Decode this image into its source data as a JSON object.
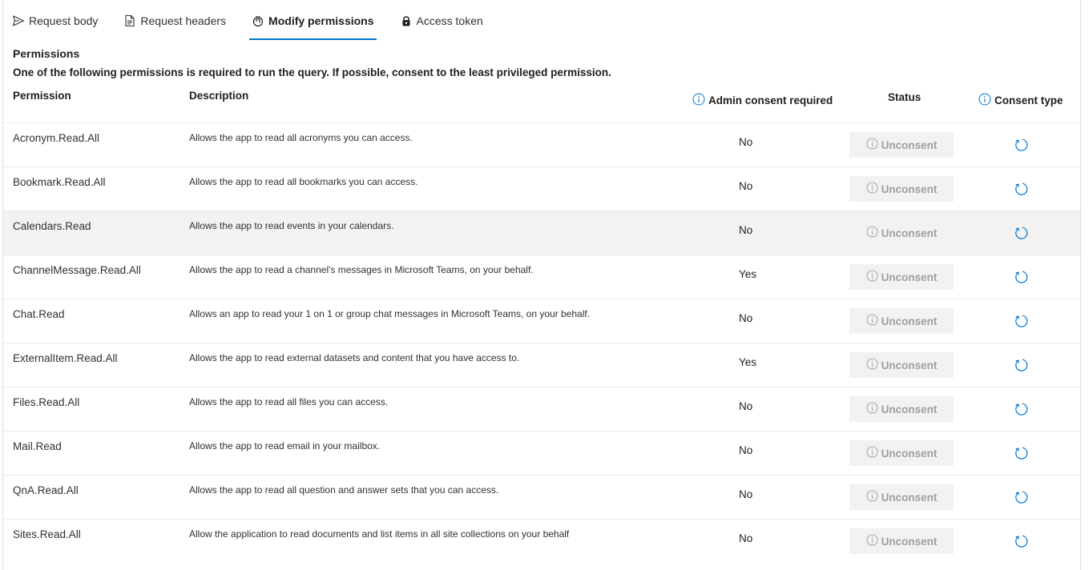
{
  "tabs": [
    {
      "label": "Request body",
      "icon": "send-icon",
      "active": false
    },
    {
      "label": "Request headers",
      "icon": "document-header-icon",
      "active": false
    },
    {
      "label": "Modify permissions",
      "icon": "shield-hand-icon",
      "active": true
    },
    {
      "label": "Access token",
      "icon": "lock-icon",
      "active": false
    }
  ],
  "section": {
    "title": "Permissions",
    "description": "One of the following permissions is required to run the query. If possible, consent to the least privileged permission."
  },
  "columns": {
    "permission": "Permission",
    "description": "Description",
    "admin_consent": "Admin consent required",
    "status": "Status",
    "consent_type": "Consent type"
  },
  "status_button_label": "Unconsent",
  "rows": [
    {
      "permission": "Acronym.Read.All",
      "description": "Allows the app to read all acronyms you can access.",
      "admin": "No"
    },
    {
      "permission": "Bookmark.Read.All",
      "description": "Allows the app to read all bookmarks you can access.",
      "admin": "No"
    },
    {
      "permission": "Calendars.Read",
      "description": "Allows the app to read events in your calendars.",
      "admin": "No"
    },
    {
      "permission": "ChannelMessage.Read.All",
      "description": "Allows the app to read a channel's messages in Microsoft Teams, on your behalf.",
      "admin": "Yes"
    },
    {
      "permission": "Chat.Read",
      "description": "Allows an app to read your 1 on 1 or group chat messages in Microsoft Teams, on your behalf.",
      "admin": "No"
    },
    {
      "permission": "ExternalItem.Read.All",
      "description": "Allows the app to read external datasets and content that you have access to.",
      "admin": "Yes"
    },
    {
      "permission": "Files.Read.All",
      "description": "Allows the app to read all files you can access.",
      "admin": "No"
    },
    {
      "permission": "Mail.Read",
      "description": "Allows the app to read email in your mailbox.",
      "admin": "No"
    },
    {
      "permission": "QnA.Read.All",
      "description": "Allows the app to read all question and answer sets that you can access.",
      "admin": "No"
    },
    {
      "permission": "Sites.Read.All",
      "description": "Allow the application to read documents and list items in all site collections on your behalf",
      "admin": "No"
    }
  ],
  "colors": {
    "accent": "#0078d4",
    "disabled_text": "#a19f9d",
    "row_hover": "#f3f2f1"
  }
}
